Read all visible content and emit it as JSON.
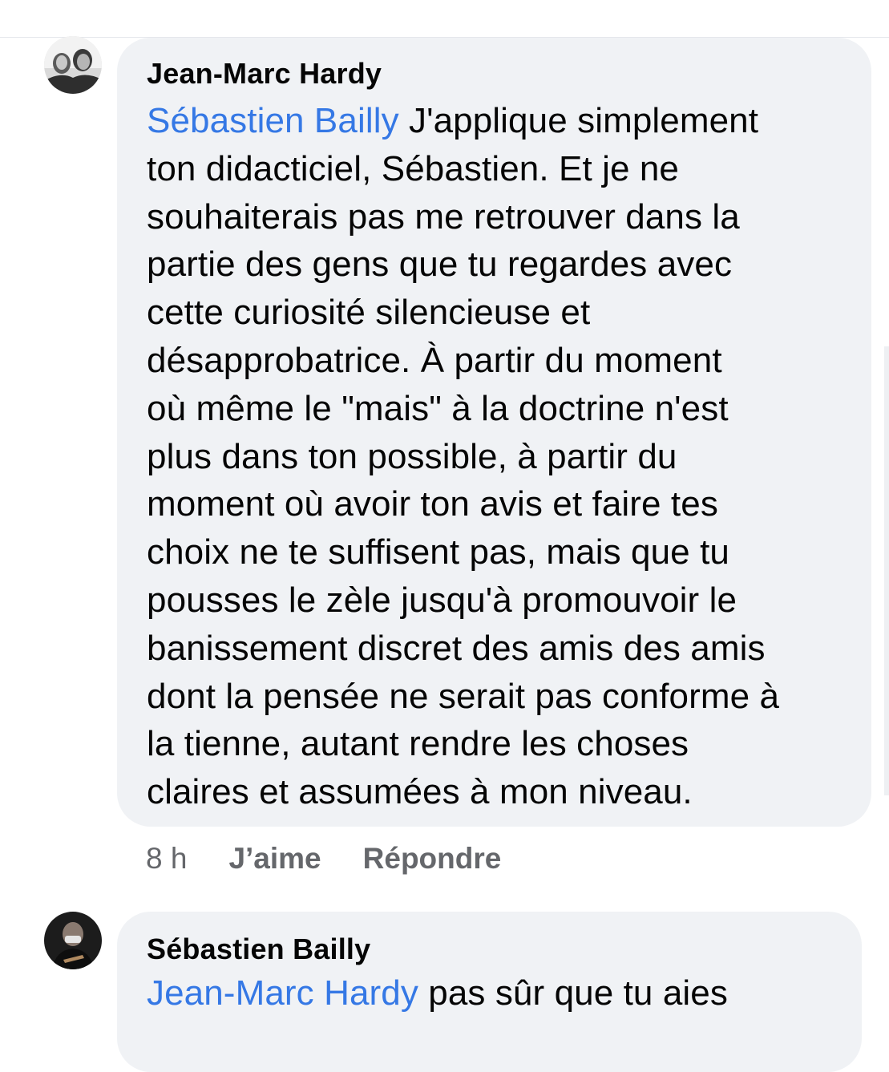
{
  "comments": [
    {
      "author": "Jean-Marc Hardy",
      "mention": "Sébastien Bailly",
      "text_lines": [
        " J'applique simplement",
        "ton didacticiel, Sébastien. Et je ne",
        "souhaiterais pas me retrouver dans la",
        "partie des gens que tu regardes avec",
        "cette curiosité silencieuse et",
        "désapprobatrice. À partir du moment",
        "où même le \"mais\" à la doctrine n'est",
        "plus dans ton possible, à partir du",
        "moment où avoir ton avis et faire tes",
        "choix ne te suffisent pas, mais que tu",
        "pousses le zèle jusqu'à promouvoir le",
        "banissement discret des amis des amis",
        "dont la pensée ne serait pas conforme à",
        "la tienne, autant rendre les choses",
        "claires et assumées à mon niveau."
      ],
      "time": "8 h",
      "like_label": "J’aime",
      "reply_label": "Répondre",
      "avatar_icon": "user-photo-avatar"
    },
    {
      "author": "Sébastien Bailly",
      "mention": "Jean-Marc Hardy",
      "text_lines": [
        " pas sûr que tu aies"
      ],
      "avatar_icon": "user-photo-avatar"
    }
  ],
  "colors": {
    "bubble_bg": "#f0f2f5",
    "mention": "#3578e5",
    "meta_text": "#65676b",
    "text": "#050505"
  }
}
